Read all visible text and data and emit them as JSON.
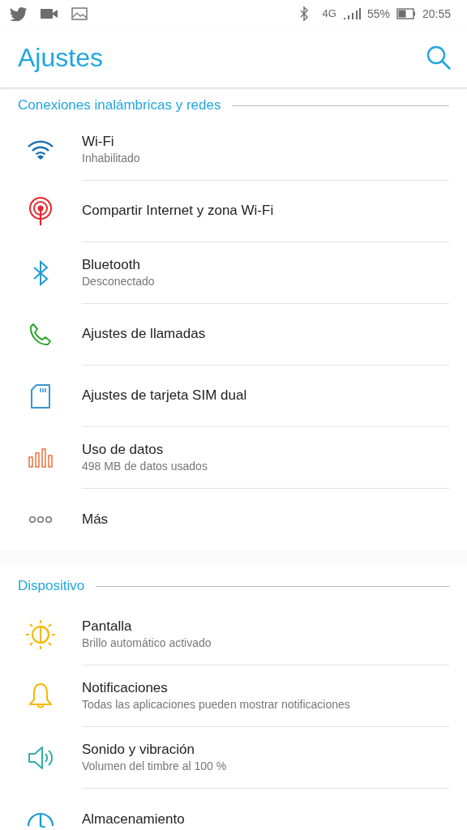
{
  "status_bar": {
    "network": "4G",
    "battery": "55%",
    "time": "20:55"
  },
  "header": {
    "title": "Ajustes"
  },
  "sections": [
    {
      "title": "Conexiones inalámbricas y redes",
      "items": [
        {
          "kind": "wifi",
          "title": "Wi-Fi",
          "subtitle": "Inhabilitado"
        },
        {
          "kind": "hotspot",
          "title": "Compartir Internet y zona Wi-Fi"
        },
        {
          "kind": "bluetooth",
          "title": "Bluetooth",
          "subtitle": "Desconectado"
        },
        {
          "kind": "phone",
          "title": "Ajustes de llamadas"
        },
        {
          "kind": "sim",
          "title": "Ajustes de tarjeta SIM dual"
        },
        {
          "kind": "data",
          "title": "Uso de datos",
          "subtitle": "498 MB de datos usados"
        },
        {
          "kind": "more",
          "title": "Más"
        }
      ]
    },
    {
      "title": "Dispositivo",
      "items": [
        {
          "kind": "display",
          "title": "Pantalla",
          "subtitle": "Brillo automático activado"
        },
        {
          "kind": "bell",
          "title": "Notificaciones",
          "subtitle": "Todas las aplicaciones pueden mostrar notificaciones"
        },
        {
          "kind": "sound",
          "title": "Sonido y vibración",
          "subtitle": "Volumen del timbre al 100 %"
        },
        {
          "kind": "storage",
          "title": "Almacenamiento"
        }
      ]
    }
  ]
}
